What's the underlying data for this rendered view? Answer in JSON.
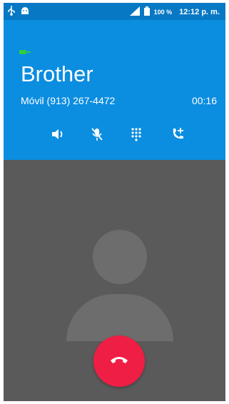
{
  "status_bar": {
    "battery_percent": "100 %",
    "time": "12:12 p. m.",
    "icons": [
      "usb-icon",
      "android-icon",
      "signal-icon",
      "battery-icon"
    ]
  },
  "call": {
    "hd_voice_icon": "hd-voice-icon",
    "contact_name": "Brother",
    "number_label": "Móvil (913) 267-4472",
    "elapsed": "00:16"
  },
  "controls": [
    {
      "icon": "speaker-icon"
    },
    {
      "icon": "mute-icon"
    },
    {
      "icon": "dialpad-icon"
    },
    {
      "icon": "add-call-icon"
    }
  ],
  "end_call": {
    "icon": "end-call-icon"
  },
  "colors": {
    "status_bar": "#0778c4",
    "call_card": "#0b8de0",
    "background": "#5a5a5a",
    "avatar": "#6d6d6d",
    "end_call": "#ee1e44",
    "hd_icon": "#2ecc40"
  }
}
